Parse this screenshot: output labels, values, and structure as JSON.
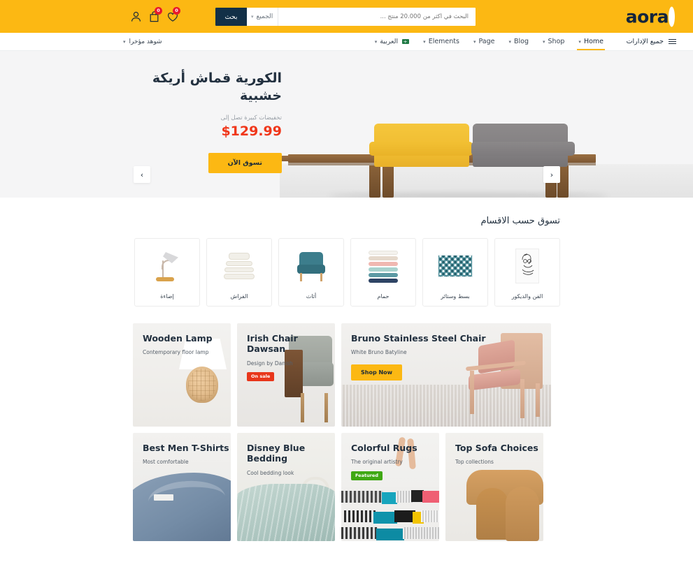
{
  "header": {
    "logo_text": "aora",
    "logo_dot": ".",
    "search": {
      "button_label": "بحث",
      "category_label": "الجميع",
      "placeholder": "البحث في أكثر من 20.000 منتج ...",
      "value": ""
    },
    "icons": {
      "account": "user-icon",
      "cart": "shopping-bag-icon",
      "wishlist": "heart-icon",
      "cart_count": "0",
      "wishlist_count": "0"
    }
  },
  "nav": {
    "departments_label": "جميع الإدارات",
    "recent_label": "شوهد مؤخرا",
    "items": [
      {
        "label": "Home",
        "active": true
      },
      {
        "label": "Shop",
        "active": false
      },
      {
        "label": "Blog",
        "active": false
      },
      {
        "label": "Page",
        "active": false
      },
      {
        "label": "Elements",
        "active": false
      },
      {
        "label": "العربية",
        "active": false
      }
    ]
  },
  "hero": {
    "title": "الكورية قماش أريكة خشبية",
    "subtitle": "تخفيضات كبيرة تصل إلى",
    "price": "$129.99",
    "cta_label": "تسوق الآن",
    "prev_icon": "chevron-left-icon",
    "next_icon": "chevron-right-icon",
    "slide_count": 2,
    "active_slide": 1
  },
  "categories": {
    "title": "تسوق حسب الاقسام",
    "items": [
      {
        "label": "الفن والديكور",
        "icon": "framed-art-icon"
      },
      {
        "label": "بسط وستائر",
        "icon": "rug-icon"
      },
      {
        "label": "حمام",
        "icon": "towels-icon"
      },
      {
        "label": "أثاث",
        "icon": "armchair-icon"
      },
      {
        "label": "الفراش",
        "icon": "bedding-icon"
      },
      {
        "label": "إضاءة",
        "icon": "desk-lamp-icon"
      }
    ]
  },
  "promos": {
    "row1": [
      {
        "title": "Wooden Lamp",
        "subtitle": "Contemporary floor lamp",
        "badge": "",
        "cta": ""
      },
      {
        "title": "Irish Chair Dawsan",
        "subtitle": "Design by Danish",
        "badge": "On sale",
        "cta": ""
      },
      {
        "title": "Bruno Stainless Steel Chair",
        "subtitle": "White Bruno Batyline",
        "badge": "",
        "cta": "Shop Now"
      }
    ],
    "row2": [
      {
        "title": "Best Men T-Shirts",
        "subtitle": "Most comfortable",
        "badge": "",
        "cta": ""
      },
      {
        "title": "Disney Blue Bedding",
        "subtitle": "Cool bedding look",
        "badge": "",
        "cta": ""
      },
      {
        "title": "Colorful Rugs",
        "subtitle": "The original artistry",
        "badge": "Featured",
        "cta": ""
      },
      {
        "title": "Top Sofa Choices",
        "subtitle": "Top collections",
        "badge": "",
        "cta": ""
      }
    ]
  },
  "colors": {
    "brand_yellow": "#fcb813",
    "dark_navy": "#123047",
    "price_red": "#f0371b",
    "sale_red": "#e8361b",
    "featured_green": "#3fa814",
    "badge_red": "#e8192c"
  }
}
